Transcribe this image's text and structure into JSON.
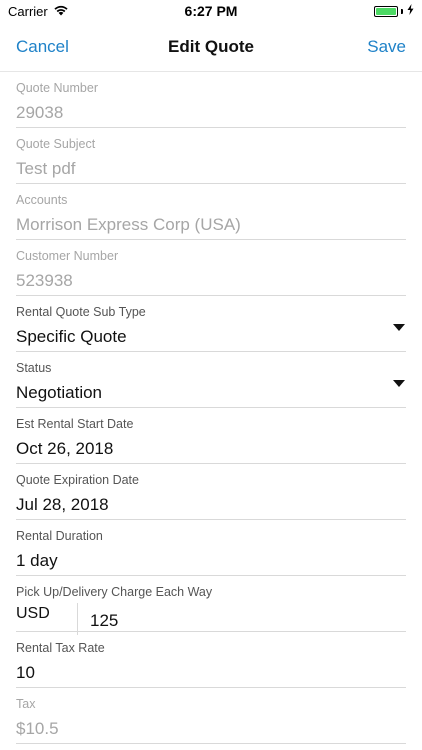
{
  "status_bar": {
    "carrier": "Carrier",
    "time": "6:27 PM",
    "battery_level": 1.0,
    "battery_color": "#4cd964"
  },
  "nav": {
    "cancel_label": "Cancel",
    "title": "Edit Quote",
    "save_label": "Save",
    "accent_color": "#1f82c8"
  },
  "fields": {
    "quote_number": {
      "label": "Quote Number",
      "value": "29038"
    },
    "quote_subject": {
      "label": "Quote Subject",
      "value": "Test pdf"
    },
    "accounts": {
      "label": "Accounts",
      "value": "Morrison Express Corp (USA)"
    },
    "customer_number": {
      "label": "Customer Number",
      "value": "523938"
    },
    "rental_quote_sub_type": {
      "label": "Rental Quote Sub Type",
      "value": "Specific Quote"
    },
    "status": {
      "label": "Status",
      "value": "Negotiation"
    },
    "est_rental_start_date": {
      "label": "Est Rental Start Date",
      "value": "Oct 26, 2018"
    },
    "quote_expiration_date": {
      "label": "Quote Expiration Date",
      "value": "Jul 28, 2018"
    },
    "rental_duration": {
      "label": "Rental Duration",
      "value": "1 day"
    },
    "pickup_delivery_charge": {
      "label": "Pick Up/Delivery Charge Each Way",
      "currency": "USD",
      "value": "125"
    },
    "rental_tax_rate": {
      "label": "Rental Tax Rate",
      "value": "10"
    },
    "tax": {
      "label": "Tax",
      "value": "$10.5"
    }
  }
}
